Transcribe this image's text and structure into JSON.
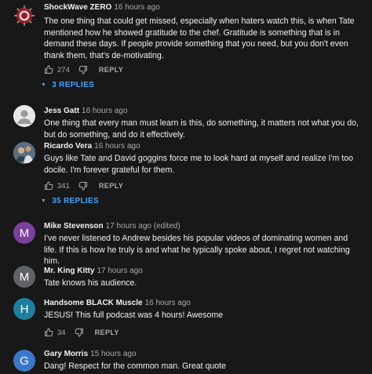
{
  "comments": [
    {
      "author": "ShockWave ZERO",
      "time": "16 hours ago",
      "text": "The one thing that could get missed, especially when haters watch this, is when Tate mentioned how he showed gratitude to the chef. Gratitude is something that is in demand these days. If people provide something that you need, but you don't even thank them, that's de-motivating.",
      "likes": "274",
      "reply_label": "REPLY",
      "replies_label": "3 REPLIES",
      "avatar_color": "#9b1b22"
    },
    {
      "author": "Jess Gatt",
      "time": "16 hours ago",
      "text": "One thing that every man must learn is this, do something, it matters not what you do, but do something, and do it effectively.",
      "avatar_color": "#e8e8e8"
    },
    {
      "author": "Ricardo Vera",
      "time": "16 hours ago",
      "text": "Guys like Tate and David goggins force me to look hard at myself and realize I'm too docile. I'm forever grateful for them.",
      "likes": "341",
      "reply_label": "REPLY",
      "replies_label": "35 REPLIES",
      "avatar_color": "#4a6a80"
    },
    {
      "author": "Mike Stevenson",
      "time": "17 hours ago (edited)",
      "text": "I've never listened to Andrew besides his popular videos of dominating women and life. If this is how he truly is and what he typically spoke about, I regret not watching him.",
      "avatar_letter": "M",
      "avatar_color": "#7b3f9f"
    },
    {
      "author": "Mr. King Kitty",
      "time": "17 hours ago",
      "text": "Tate knows his audience.",
      "avatar_letter": "M",
      "avatar_color": "#5f6368"
    },
    {
      "author": "Handsome BLACK Muscle",
      "time": "16 hours ago",
      "text": "JESUS! This full podcast was 4 hours! Awesome",
      "likes": "34",
      "reply_label": "REPLY",
      "avatar_letter": "H",
      "avatar_color": "#1e7f9f"
    },
    {
      "author": "Gary Morris",
      "time": "15 hours ago",
      "text": "Dang! Respect for the common man. Great quote",
      "avatar_letter": "G",
      "avatar_color": "#3c78c8"
    }
  ]
}
